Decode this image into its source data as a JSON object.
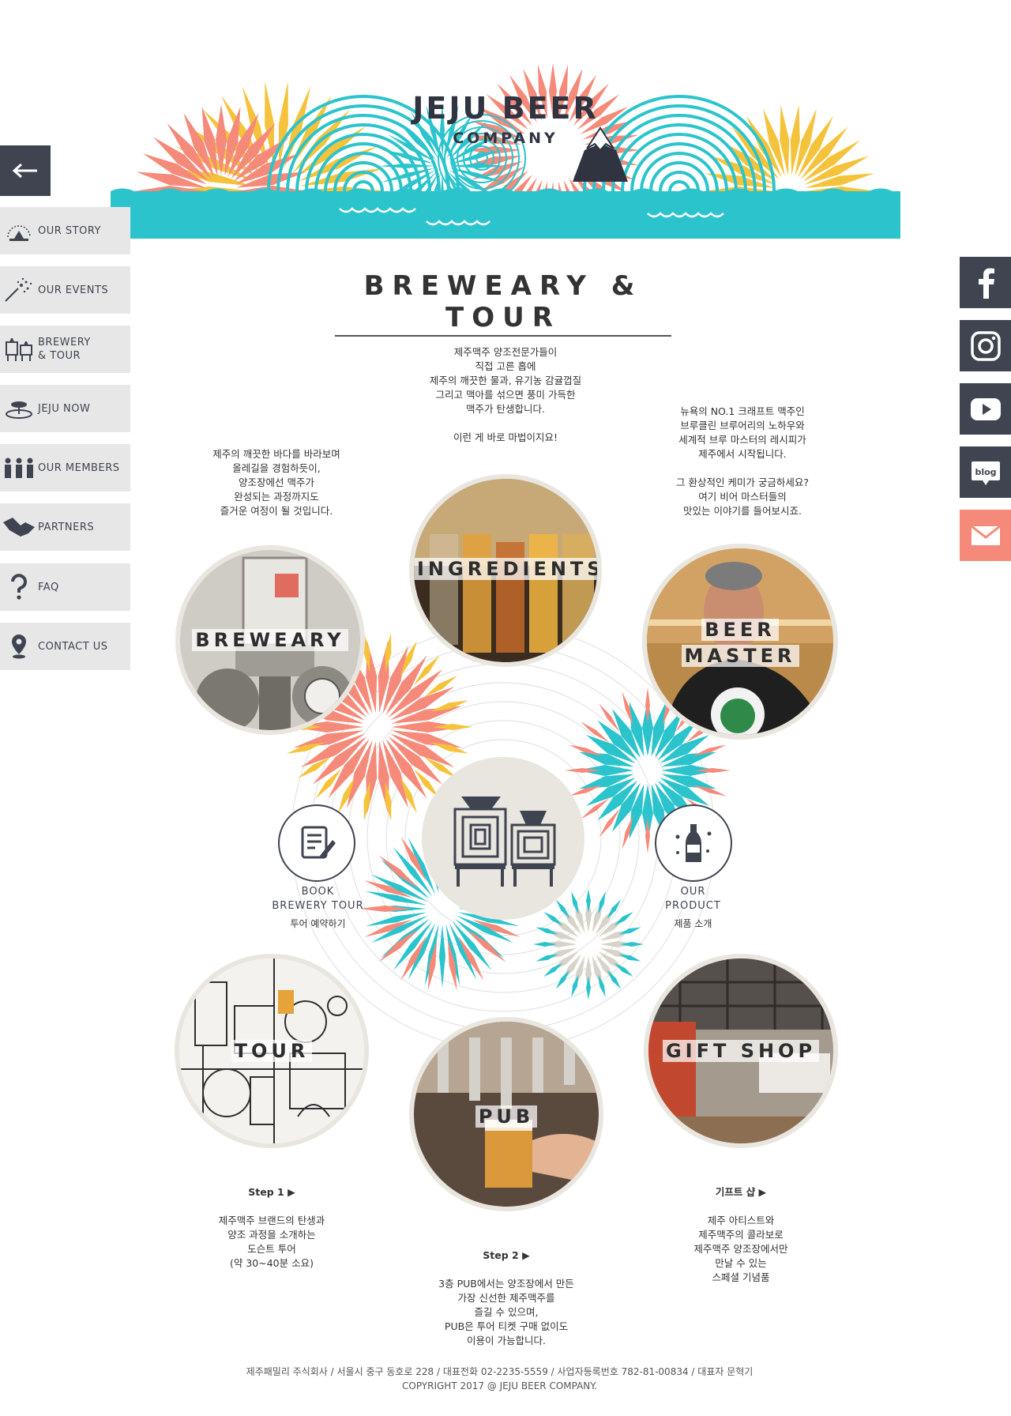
{
  "brand": {
    "title_line1": "JEJU BEER",
    "title_line2": "COMPANY"
  },
  "colors": {
    "teal": "#2bc4cc",
    "coral": "#f58a7a",
    "yellow": "#f5c33b",
    "dark": "#3f4450",
    "navbg": "#e7e7e7",
    "mail": "#f58a7a"
  },
  "nav": {
    "back_icon": "arrow-left-icon",
    "items": [
      {
        "label": "OUR STORY",
        "icon": "jeju-badge-icon"
      },
      {
        "label": "OUR EVENTS",
        "icon": "fireworks-icon"
      },
      {
        "label": "BREWERY\n& TOUR",
        "icon": "brewery-tanks-icon"
      },
      {
        "label": "JEJU NOW",
        "icon": "island-icon"
      },
      {
        "label": "OUR MEMBERS",
        "icon": "people-icon"
      },
      {
        "label": "PARTNERS",
        "icon": "handshake-icon"
      },
      {
        "label": "FAQ",
        "icon": "question-icon"
      },
      {
        "label": "CONTACT US",
        "icon": "map-pin-icon"
      }
    ]
  },
  "social": [
    {
      "name": "facebook",
      "icon": "facebook-icon",
      "color": "#3f4450"
    },
    {
      "name": "instagram",
      "icon": "instagram-icon",
      "color": "#3f4450"
    },
    {
      "name": "youtube",
      "icon": "youtube-icon",
      "color": "#3f4450"
    },
    {
      "name": "blog",
      "icon": "blog-icon",
      "label": "blog",
      "color": "#3f4450"
    },
    {
      "name": "mail",
      "icon": "mail-icon",
      "color": "#f58a7a"
    }
  ],
  "page_title": "BREWEARY & TOUR",
  "descriptions": {
    "ingredients": "제주맥주 양조전문가들이\n직접 고른 홉에\n제주의 깨끗한 물과, 유기농 감귤껍질\n그리고 맥아를 섞으면 풍미 가득한\n맥주가 탄생합니다.\n\n이런 게 바로 마법이지요!",
    "brewery": "제주의 깨끗한 바다를 바라보며\n올레길을 경험하듯이,\n양조장에선 맥주가\n완성되는 과정까지도\n즐거운 여정이 될 것입니다.",
    "beer_master": "뉴욕의 NO.1 크래프트 맥주인\n브루클린 브루어리의 노하우와\n세계적 브루 마스터의 레시피가\n제주에서 시작됩니다.\n\n그 환상적인 케미가 궁금하세요?\n여기 비어 마스터들의\n맛있는 이야기를 들어보시죠.",
    "tour_step": "Step 1 ▶",
    "tour": "제주맥주 브랜드의 탄생과\n양조 과정을 소개하는\n도슨트 투어\n(약 30~40분 소요)",
    "pub_step": "Step 2 ▶",
    "pub": "3층 PUB에서는 양조장에서 만든\n가장 신선한 제주맥주를\n즐길 수 있으며,\nPUB은 투어 티켓 구매 없이도\n이용이 가능합니다.",
    "shop_step": "기프트 샵 ▶",
    "shop": "제주 아티스트와\n제주맥주의 콜라보로\n제주맥주 양조장에서만\n만날 수 있는\n스페셜 기념품"
  },
  "circles": {
    "ingredients": "INGREDIENTS",
    "brewery": "BREWEARY",
    "beer_master_1": "BEER",
    "beer_master_2": "MASTER",
    "tour": "TOUR",
    "pub": "PUB",
    "gift_shop": "GIFT SHOP"
  },
  "center": {
    "book_label": "BOOK\nBREWERY TOUR",
    "book_sub": "투어 예약하기",
    "book_icon": "clipboard-pen-icon",
    "product_label": "OUR\nPRODUCT",
    "product_sub": "제품 소개",
    "product_icon": "beer-bottle-icon",
    "brewhouse_icon": "brew-kettles-icon"
  },
  "footer": {
    "line1": "제주패밀리 주식회사 / 서울시 중구 동호로 228 / 대표전화 02-2235-5559 / 사업자등록번호 782-81-00834 / 대표자 문혁기",
    "line2": "COPYRIGHT 2017 @ JEJU BEER COMPANY."
  }
}
